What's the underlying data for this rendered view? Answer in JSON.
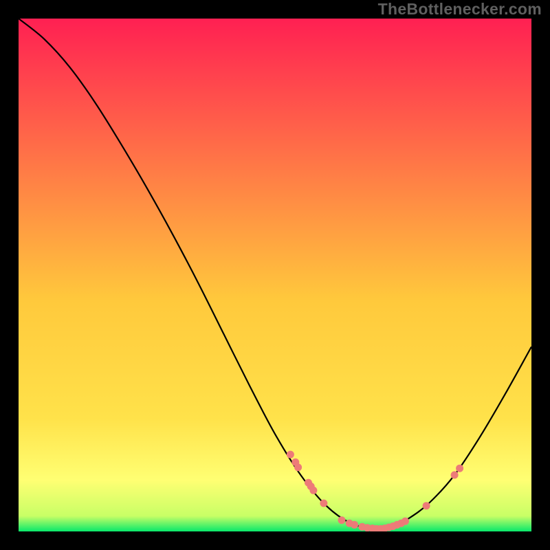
{
  "watermark": "TheBottlenecker.com",
  "colors": {
    "bg": "#000000",
    "text": "#5f5f5f",
    "curve": "#000000",
    "dot": "#ed7b78",
    "grad_top": "#ff2052",
    "grad_mid": "#ffe24a",
    "grad_low": "#ffff73",
    "grad_bottom": "#08e86b"
  },
  "chart_data": {
    "type": "line",
    "title": "",
    "xlabel": "",
    "ylabel": "",
    "xlim": [
      0,
      100
    ],
    "ylim": [
      0,
      100
    ],
    "curve": [
      {
        "x": 0,
        "y": 100.0
      },
      {
        "x": 5,
        "y": 96.0
      },
      {
        "x": 10,
        "y": 90.5
      },
      {
        "x": 15,
        "y": 83.5
      },
      {
        "x": 20,
        "y": 75.5
      },
      {
        "x": 25,
        "y": 67.0
      },
      {
        "x": 30,
        "y": 58.0
      },
      {
        "x": 35,
        "y": 48.5
      },
      {
        "x": 40,
        "y": 38.5
      },
      {
        "x": 45,
        "y": 28.5
      },
      {
        "x": 50,
        "y": 19.0
      },
      {
        "x": 55,
        "y": 11.0
      },
      {
        "x": 60,
        "y": 5.0
      },
      {
        "x": 65,
        "y": 1.5
      },
      {
        "x": 70,
        "y": 0.5
      },
      {
        "x": 73,
        "y": 1.0
      },
      {
        "x": 76,
        "y": 2.5
      },
      {
        "x": 80,
        "y": 5.5
      },
      {
        "x": 85,
        "y": 11.0
      },
      {
        "x": 90,
        "y": 18.5
      },
      {
        "x": 95,
        "y": 27.0
      },
      {
        "x": 100,
        "y": 36.0
      }
    ],
    "dots": [
      {
        "x": 53.0,
        "y": 15.0
      },
      {
        "x": 54.0,
        "y": 13.5
      },
      {
        "x": 54.5,
        "y": 12.5
      },
      {
        "x": 56.5,
        "y": 9.5
      },
      {
        "x": 57.0,
        "y": 8.8
      },
      {
        "x": 57.5,
        "y": 8.0
      },
      {
        "x": 59.5,
        "y": 5.5
      },
      {
        "x": 63.0,
        "y": 2.2
      },
      {
        "x": 64.5,
        "y": 1.6
      },
      {
        "x": 65.5,
        "y": 1.3
      },
      {
        "x": 67.0,
        "y": 0.9
      },
      {
        "x": 68.0,
        "y": 0.7
      },
      {
        "x": 69.0,
        "y": 0.6
      },
      {
        "x": 69.8,
        "y": 0.5
      },
      {
        "x": 70.6,
        "y": 0.5
      },
      {
        "x": 71.4,
        "y": 0.6
      },
      {
        "x": 72.2,
        "y": 0.8
      },
      {
        "x": 73.0,
        "y": 1.0
      },
      {
        "x": 73.8,
        "y": 1.3
      },
      {
        "x": 74.6,
        "y": 1.6
      },
      {
        "x": 75.4,
        "y": 2.0
      },
      {
        "x": 79.5,
        "y": 5.0
      },
      {
        "x": 85.0,
        "y": 11.0
      },
      {
        "x": 86.0,
        "y": 12.3
      }
    ]
  }
}
